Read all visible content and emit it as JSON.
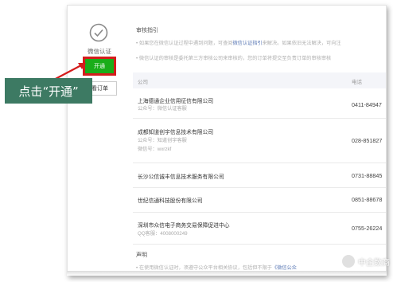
{
  "sidebar": {
    "auth_label": "微信认证",
    "open_button": "开通",
    "view_orders": "查看订单"
  },
  "guide": {
    "title": "审核指引",
    "bullet1_prefix": "如果您在微信认证过程中遇到问题，可查阅",
    "bullet1_link": "微信认证指引",
    "bullet1_suffix": "来解决。如果依旧无法解决，可向注",
    "bullet2": "微信认证的审核是委托第三方审核公司来审核的，您的订单将提交至负责订单的审核审核"
  },
  "table": {
    "col_company": "公司",
    "col_phone": "电话",
    "rows": [
      {
        "name": "上海德通企业信用征信有限公司",
        "sub1": "公众号：微信认证客服",
        "sub2": "",
        "phone": "0411-84947"
      },
      {
        "name": "成都知道创宇信息技术有限公司",
        "sub1": "公众号：知道创宇客服",
        "sub2": "微信号：wxrzkf",
        "phone": "028-851827"
      },
      {
        "name": "长沙公信诚丰信息技术服务有限公司",
        "sub1": "",
        "sub2": "",
        "phone": "0731-88845"
      },
      {
        "name": "世纪信通科技股份有限公司",
        "sub1": "",
        "sub2": "",
        "phone": "0851-88678"
      },
      {
        "name": "深圳市众信电子商务交易保障促进中心",
        "sub1": "QQ客服：4008000249",
        "sub2": "",
        "phone": "0755-26224"
      }
    ]
  },
  "statement": {
    "title": "声明",
    "bullet_prefix": "在使用微信认证时，须遵守公众平台相关协议，包括但不限于",
    "bullet_link": "《微信公众"
  },
  "callout": {
    "text": "点击“开通”"
  },
  "watermark": {
    "text": "中企数商"
  }
}
